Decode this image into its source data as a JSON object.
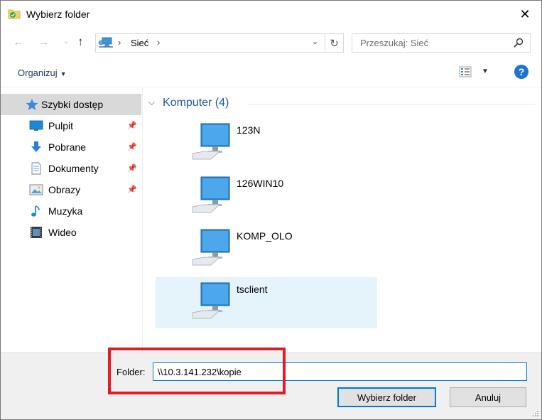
{
  "window": {
    "title": "Wybierz folder",
    "close_glyph": "✕"
  },
  "navigation": {
    "back_glyph": "←",
    "forward_glyph": "→",
    "recent_glyph": "⌄",
    "up_glyph": "↑",
    "address": {
      "separator": "›",
      "location": "Sieć",
      "dropdown_glyph": "⌄",
      "refresh_glyph": "↻"
    },
    "search": {
      "placeholder": "Przeszukaj: Sieć"
    }
  },
  "toolbar": {
    "organize_label": "Organizuj",
    "organize_caret": "▼",
    "view_caret": "▼",
    "help_glyph": "?"
  },
  "sidebar": {
    "pin_glyph": "📌",
    "quick_access": {
      "label": "Szybki dostęp",
      "icon": "star-icon"
    },
    "items": [
      {
        "label": "Pulpit",
        "icon": "desktop-icon",
        "pinned": true
      },
      {
        "label": "Pobrane",
        "icon": "download-icon",
        "pinned": true
      },
      {
        "label": "Dokumenty",
        "icon": "document-icon",
        "pinned": true
      },
      {
        "label": "Obrazy",
        "icon": "pictures-icon",
        "pinned": true
      },
      {
        "label": "Muzyka",
        "icon": "music-icon",
        "pinned": false
      },
      {
        "label": "Wideo",
        "icon": "video-icon",
        "pinned": false
      }
    ]
  },
  "main": {
    "group": {
      "chevron": "⌵",
      "label": "Komputer (4)"
    },
    "computers": [
      {
        "name": "123N",
        "selected": false
      },
      {
        "name": "126WIN10",
        "selected": false
      },
      {
        "name": "KOMP_OLO",
        "selected": false
      },
      {
        "name": "tsclient",
        "selected": true
      }
    ]
  },
  "footer": {
    "folder_label": "Folder:",
    "folder_value": "\\\\10.3.141.232\\kopie",
    "select_button": "Wybierz folder",
    "cancel_button": "Anuluj"
  },
  "colors": {
    "accent": "#0078d7",
    "highlight_red": "#e31c24",
    "selection": "#e5f3fb"
  }
}
